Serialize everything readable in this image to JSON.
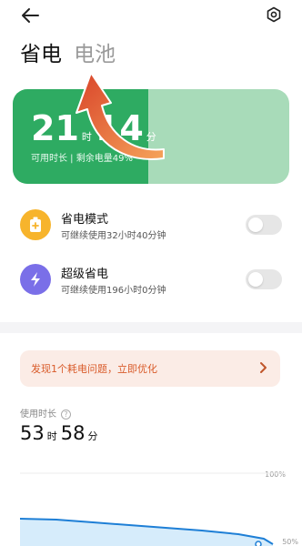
{
  "header": {
    "tabs": [
      {
        "label": "省电",
        "active": true
      },
      {
        "label": "电池",
        "active": false
      }
    ]
  },
  "battery": {
    "hours": "21",
    "hours_unit": "时",
    "minutes": "14",
    "minutes_unit": "分",
    "summary": "可用时长 | 剩余电量49%",
    "level_fraction": 0.49,
    "color_fill": "#2eab62",
    "color_track": "#a8dbb9"
  },
  "modes": [
    {
      "title": "省电模式",
      "desc": "可继续使用32小时40分钟",
      "icon": "battery-plus-icon",
      "color": "#f7b42c",
      "enabled": false
    },
    {
      "title": "超级省电",
      "desc": "可继续使用196小时0分钟",
      "icon": "lightning-icon",
      "color": "#7a6fe8",
      "enabled": false
    }
  ],
  "alert": {
    "text": "发现1个耗电问题，立即优化",
    "color": "#d95b2a",
    "background": "#fbece6"
  },
  "usage": {
    "label": "使用时长",
    "hours": "53",
    "hours_unit": "时",
    "minutes": "58",
    "minutes_unit": "分",
    "pct_top": "100%",
    "pct_bottom": "50%"
  },
  "annotation": {
    "color": "#e8733a"
  }
}
